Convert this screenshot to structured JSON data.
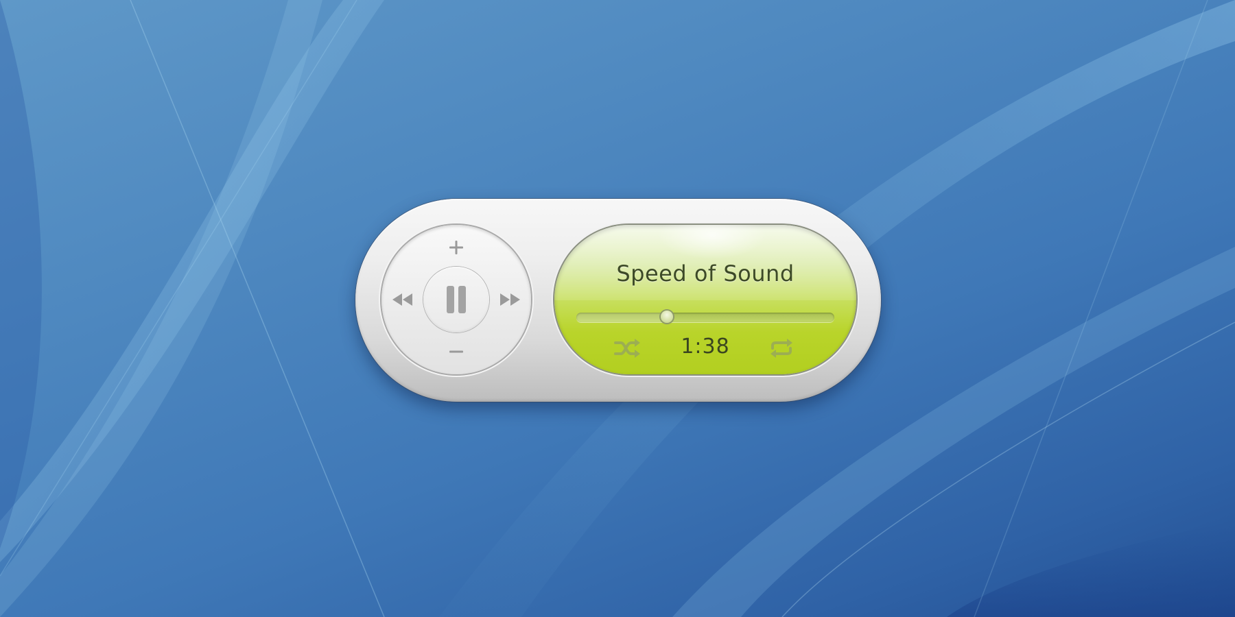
{
  "player": {
    "track_title": "Speed of Sound",
    "elapsed_time": "1:38",
    "progress": 0.35
  },
  "controls": {
    "volume_up_icon": "plus-icon",
    "volume_down_icon": "minus-icon",
    "previous_icon": "rewind-icon",
    "next_icon": "fast-forward-icon",
    "play_pause_icon": "pause-icon",
    "shuffle_icon": "shuffle-icon",
    "repeat_icon": "repeat-icon"
  },
  "colors": {
    "lcd_green": "#bdd62e",
    "wheel_glyph": "#9a9a9a",
    "lcd_glyph": "#9cae52",
    "desktop_blue": "#3f78b7"
  }
}
